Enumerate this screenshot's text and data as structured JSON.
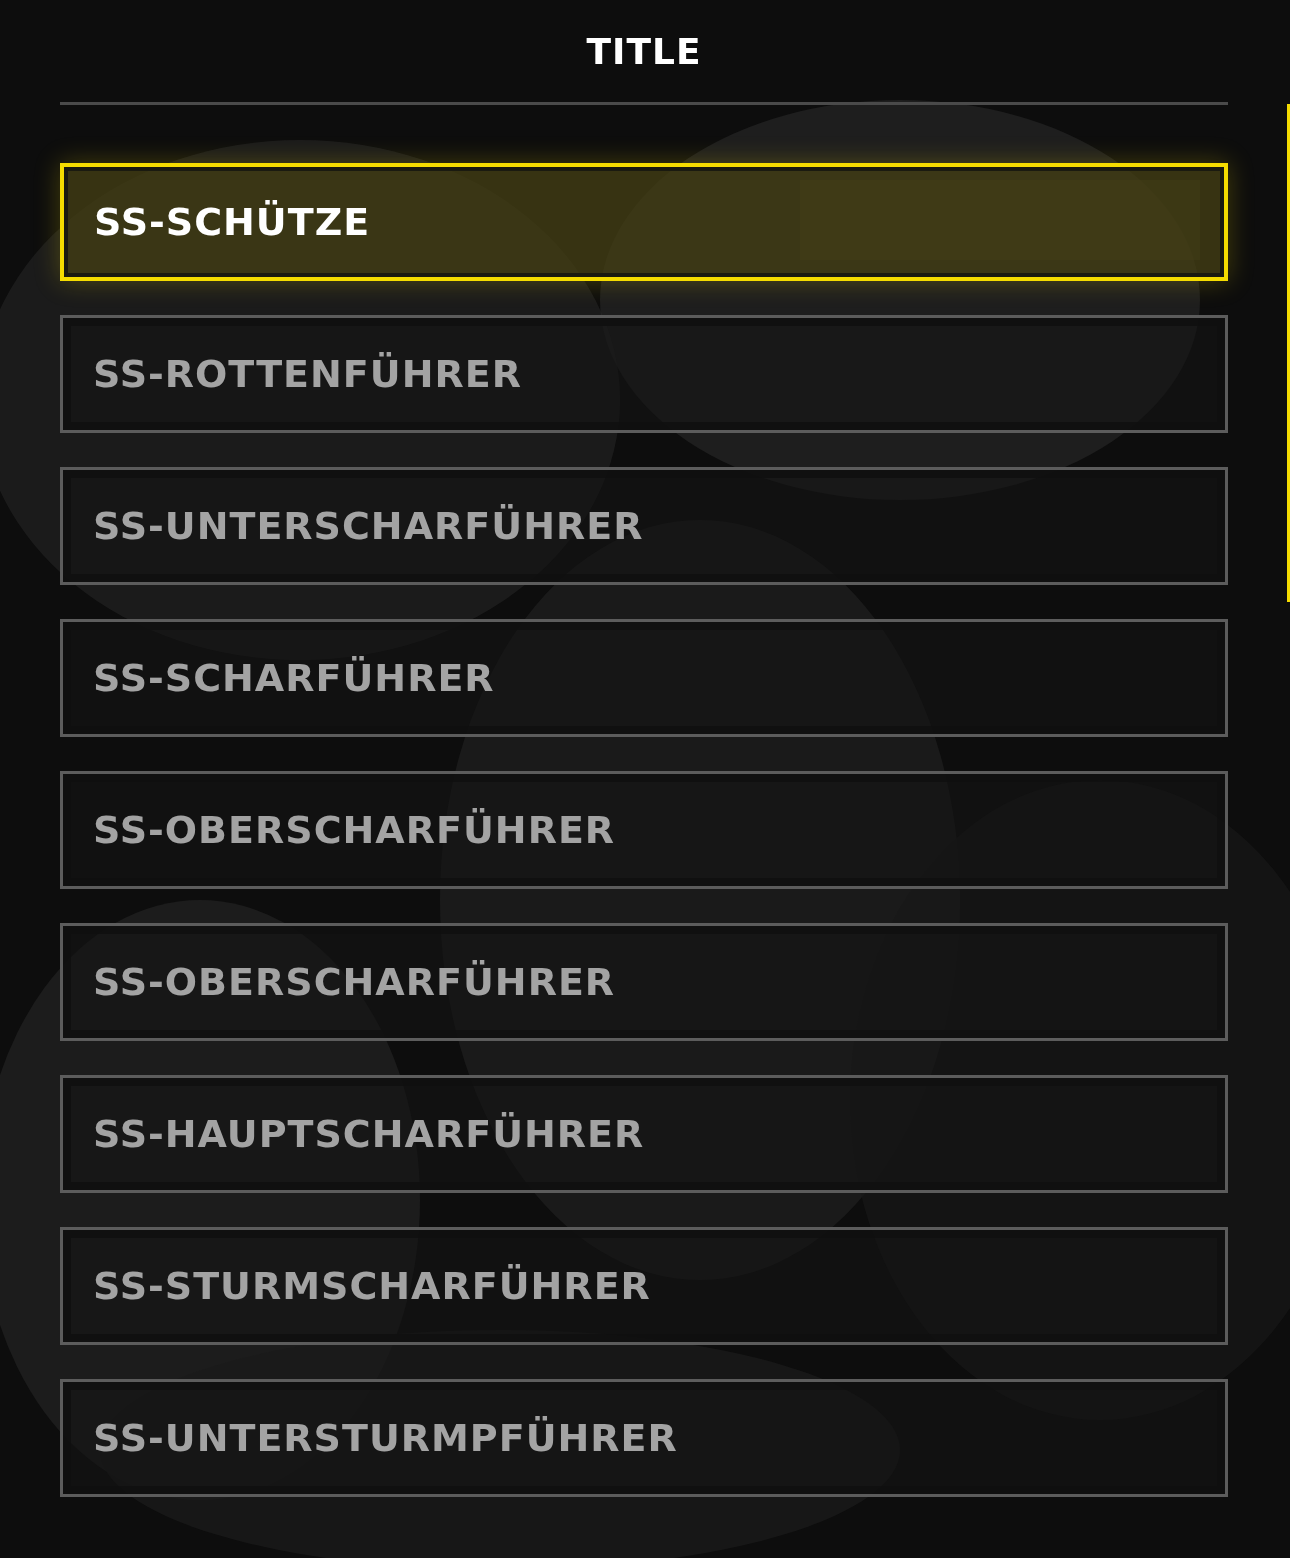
{
  "title": "TITLE",
  "ranks": [
    {
      "label": "SS-SCHÜTZE",
      "selected": true
    },
    {
      "label": "SS-ROTTENFÜHRER",
      "selected": false
    },
    {
      "label": "SS-UNTERSCHARFÜHRER",
      "selected": false
    },
    {
      "label": "SS-SCHARFÜHRER",
      "selected": false
    },
    {
      "label": "SS-OBERSCHARFÜHRER",
      "selected": false
    },
    {
      "label": "SS-OBERSCHARFÜHRER",
      "selected": false
    },
    {
      "label": "SS-HAUPTSCHARFÜHRER",
      "selected": false
    },
    {
      "label": "SS-STURMSCHARFÜHRER",
      "selected": false
    },
    {
      "label": "SS-UNTERSTURMPFÜHRER",
      "selected": false
    }
  ]
}
